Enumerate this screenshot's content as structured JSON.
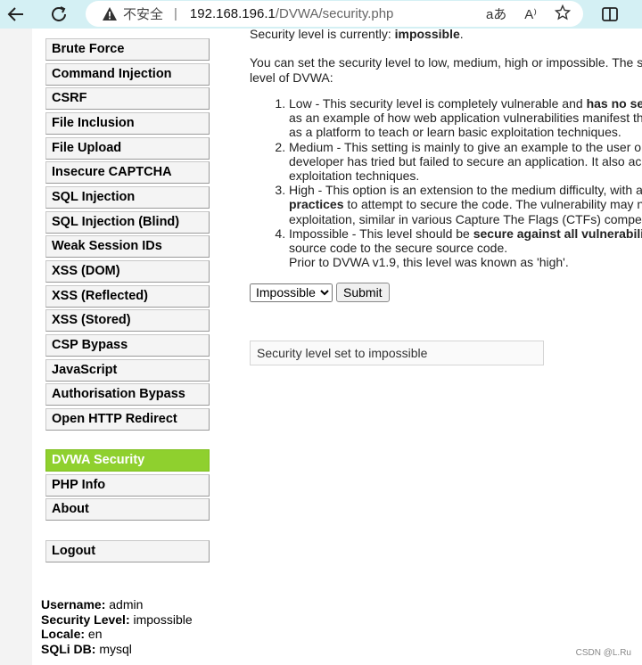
{
  "browser": {
    "insecure_label": "不安全",
    "separator": "|",
    "url_host": "192.168.196.1",
    "url_path": "/DVWA/security.php",
    "read_aloud_icon": "aあ",
    "font_icon": "A⁾"
  },
  "sidebar": {
    "items": [
      {
        "label": "Brute Force"
      },
      {
        "label": "Command Injection"
      },
      {
        "label": "CSRF"
      },
      {
        "label": "File Inclusion"
      },
      {
        "label": "File Upload"
      },
      {
        "label": "Insecure CAPTCHA"
      },
      {
        "label": "SQL Injection"
      },
      {
        "label": "SQL Injection (Blind)"
      },
      {
        "label": "Weak Session IDs"
      },
      {
        "label": "XSS (DOM)"
      },
      {
        "label": "XSS (Reflected)"
      },
      {
        "label": "XSS (Stored)"
      },
      {
        "label": "CSP Bypass"
      },
      {
        "label": "JavaScript"
      },
      {
        "label": "Authorisation Bypass"
      },
      {
        "label": "Open HTTP Redirect"
      }
    ],
    "extra_items": [
      {
        "label": "DVWA Security",
        "active": true
      },
      {
        "label": "PHP Info"
      },
      {
        "label": "About"
      }
    ],
    "logout_label": "Logout"
  },
  "user_info": {
    "username_label": "Username:",
    "username": "admin",
    "security_label": "Security Level:",
    "security": "impossible",
    "locale_label": "Locale:",
    "locale": "en",
    "sqli_label": "SQLi DB:",
    "sqli": "mysql"
  },
  "main": {
    "current_prefix": "Security level is currently: ",
    "current_level": "impossible",
    "current_suffix": ".",
    "intro_line1": "You can set the security level to low, medium, high or impossible. The s",
    "intro_line2": "level of DVWA:",
    "levels": {
      "low_a": "Low - This security level is completely vulnerable and ",
      "low_bold": "has no se",
      "low_2": "as an example of how web application vulnerabilities manifest th",
      "low_3": "as a platform to teach or learn basic exploitation techniques.",
      "med_1": "Medium - This setting is mainly to give an example to the user o",
      "med_2": "developer has tried but failed to secure an application. It also ac",
      "med_3": "exploitation techniques.",
      "high_1": "High - This option is an extension to the medium difficulty, with a",
      "high_2_bold": "practices",
      "high_2": " to attempt to secure the code. The vulnerability may n",
      "high_3": "exploitation, similar in various Capture The Flags (CTFs) compe",
      "imp_a": "Impossible - This level should be ",
      "imp_bold": "secure against all vulnerabili",
      "imp_2": "source code to the secure source code.",
      "imp_3": "Prior to DVWA v1.9, this level was known as 'high'."
    },
    "select_value": "Impossible",
    "submit_label": "Submit",
    "message": "Security level set to impossible"
  },
  "watermark": "CSDN @L.Ru"
}
